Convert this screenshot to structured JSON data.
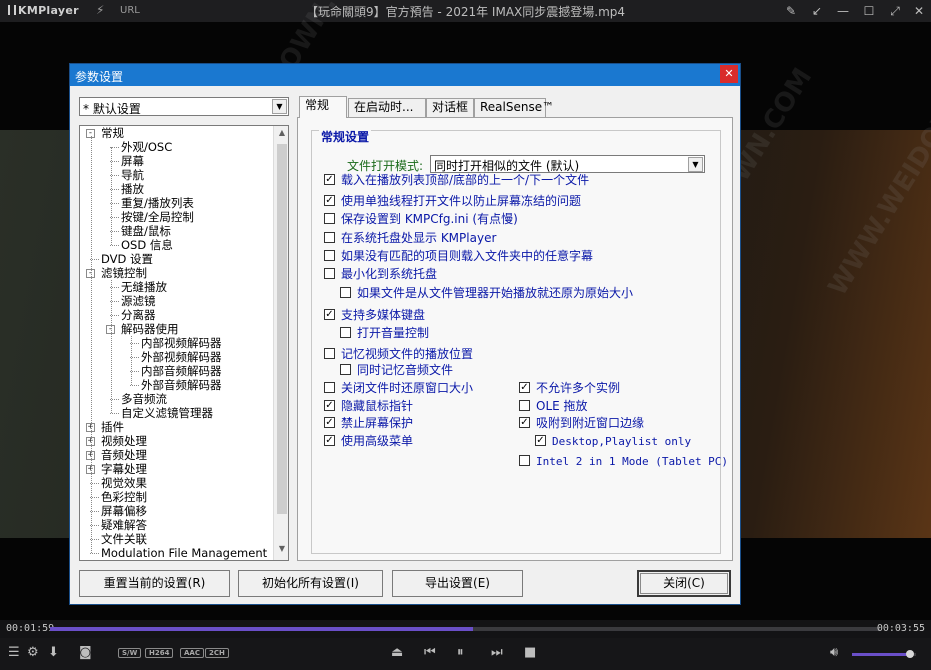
{
  "player": {
    "app_name": "KMPlayer",
    "url_label": "URL",
    "window_title": "【玩命關頭9】官方預告 - 2021年 IMAX同步震撼登場.mp4",
    "time_elapsed": "00:01:59",
    "time_total": "00:03:55",
    "progress_percent": 51,
    "volume_percent": 90,
    "badges": [
      "S/W",
      "H264",
      "AAC",
      "2CH"
    ],
    "accent_color": "#6a4fc8"
  },
  "dialog": {
    "title": "参数设置",
    "preset": "* 默认设置",
    "tree": [
      {
        "label": "常规",
        "depth": 0,
        "toggle": "-"
      },
      {
        "label": "外观/OSC",
        "depth": 1
      },
      {
        "label": "屏幕",
        "depth": 1
      },
      {
        "label": "导航",
        "depth": 1
      },
      {
        "label": "播放",
        "depth": 1
      },
      {
        "label": "重复/播放列表",
        "depth": 1
      },
      {
        "label": "按键/全局控制",
        "depth": 1
      },
      {
        "label": "键盘/鼠标",
        "depth": 1
      },
      {
        "label": "OSD 信息",
        "depth": 1
      },
      {
        "label": "DVD 设置",
        "depth": 0
      },
      {
        "label": "滤镜控制",
        "depth": 0,
        "toggle": "-"
      },
      {
        "label": "无缝播放",
        "depth": 1
      },
      {
        "label": "源滤镜",
        "depth": 1
      },
      {
        "label": "分离器",
        "depth": 1
      },
      {
        "label": "解码器使用",
        "depth": 1,
        "toggle": "-"
      },
      {
        "label": "内部视频解码器",
        "depth": 2
      },
      {
        "label": "外部视频解码器",
        "depth": 2
      },
      {
        "label": "内部音频解码器",
        "depth": 2
      },
      {
        "label": "外部音频解码器",
        "depth": 2
      },
      {
        "label": "多音频流",
        "depth": 1
      },
      {
        "label": "自定义滤镜管理器",
        "depth": 1
      },
      {
        "label": "插件",
        "depth": 0,
        "toggle": "+"
      },
      {
        "label": "视频处理",
        "depth": 0,
        "toggle": "+"
      },
      {
        "label": "音频处理",
        "depth": 0,
        "toggle": "+"
      },
      {
        "label": "字幕处理",
        "depth": 0,
        "toggle": "+"
      },
      {
        "label": "视觉效果",
        "depth": 0
      },
      {
        "label": "色彩控制",
        "depth": 0
      },
      {
        "label": "屏幕偏移",
        "depth": 0
      },
      {
        "label": "疑难解答",
        "depth": 0
      },
      {
        "label": "文件关联",
        "depth": 0
      },
      {
        "label": "Modulation File Management",
        "depth": 0
      }
    ],
    "tabs": [
      "常规",
      "在启动时...",
      "对话框",
      "RealSense™"
    ],
    "active_tab": 0,
    "panel": {
      "heading": "常规设置",
      "open_mode_label": "文件打开模式:",
      "open_mode_value": "同时打开相似的文件 (默认)",
      "options": [
        {
          "label": "载入在播放列表顶部/底部的上一个/下一个文件",
          "checked": true
        },
        {
          "label": "使用单独线程打开文件以防止屏幕冻结的问题",
          "checked": true
        },
        {
          "label": "保存设置到 KMPCfg.ini (有点慢)",
          "checked": false
        },
        {
          "label": "在系统托盘处显示 KMPlayer",
          "checked": false
        },
        {
          "label": "如果没有匹配的项目则载入文件夹中的任意字幕",
          "checked": false
        },
        {
          "label": "最小化到系统托盘",
          "checked": false
        },
        {
          "label": "如果文件是从文件管理器开始播放就还原为原始大小",
          "checked": false
        },
        {
          "label": "支持多媒体键盘",
          "checked": true
        },
        {
          "label": "打开音量控制",
          "checked": false
        },
        {
          "label": "记忆视频文件的播放位置",
          "checked": false
        },
        {
          "label": "同时记忆音频文件",
          "checked": false
        },
        {
          "label": "关闭文件时还原窗口大小",
          "checked": false
        },
        {
          "label": "隐藏鼠标指针",
          "checked": true
        },
        {
          "label": "禁止屏幕保护",
          "checked": true
        },
        {
          "label": "使用高级菜单",
          "checked": true
        },
        {
          "label": "不允许多个实例",
          "checked": true
        },
        {
          "label": "OLE 拖放",
          "checked": false
        },
        {
          "label": "吸附到附近窗口边缘",
          "checked": true
        },
        {
          "label": "Desktop,Playlist only",
          "checked": true
        },
        {
          "label": "Intel 2 in 1 Mode (Tablet PC)",
          "checked": false
        }
      ]
    },
    "buttons": {
      "reset": "重置当前的设置(R)",
      "init_all": "初始化所有设置(I)",
      "export": "导出设置(E)",
      "close": "关闭(C)"
    }
  }
}
